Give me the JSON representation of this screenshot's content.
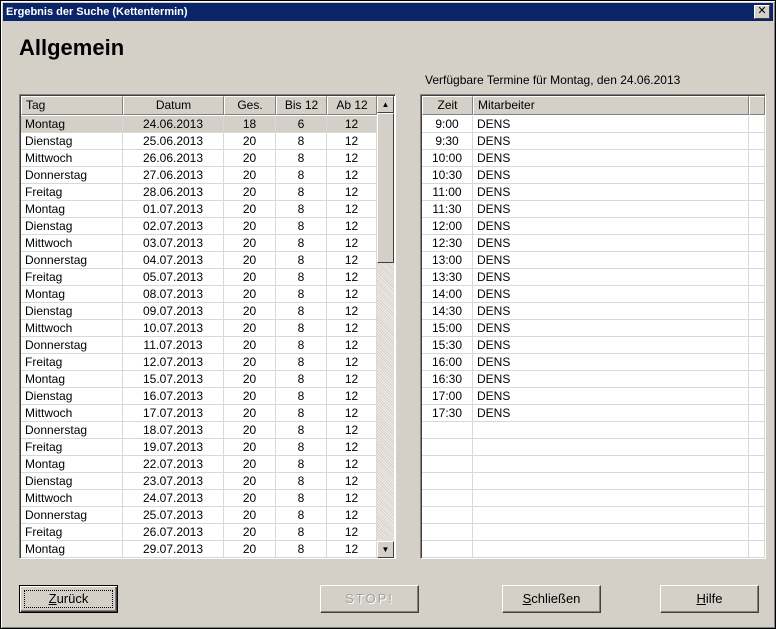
{
  "window": {
    "title": "Ergebnis der Suche (Kettentermin)",
    "close_glyph": "✕"
  },
  "heading": "Allgemein",
  "available_label": "Verfügbare Termine für  Montag, den 24.06.2013",
  "days_table": {
    "columns": [
      "Tag",
      "Datum",
      "Ges.",
      "Bis 12",
      "Ab 12"
    ],
    "selected_index": 0,
    "rows": [
      [
        "Montag",
        "24.06.2013",
        "18",
        "6",
        "12"
      ],
      [
        "Dienstag",
        "25.06.2013",
        "20",
        "8",
        "12"
      ],
      [
        "Mittwoch",
        "26.06.2013",
        "20",
        "8",
        "12"
      ],
      [
        "Donnerstag",
        "27.06.2013",
        "20",
        "8",
        "12"
      ],
      [
        "Freitag",
        "28.06.2013",
        "20",
        "8",
        "12"
      ],
      [
        "Montag",
        "01.07.2013",
        "20",
        "8",
        "12"
      ],
      [
        "Dienstag",
        "02.07.2013",
        "20",
        "8",
        "12"
      ],
      [
        "Mittwoch",
        "03.07.2013",
        "20",
        "8",
        "12"
      ],
      [
        "Donnerstag",
        "04.07.2013",
        "20",
        "8",
        "12"
      ],
      [
        "Freitag",
        "05.07.2013",
        "20",
        "8",
        "12"
      ],
      [
        "Montag",
        "08.07.2013",
        "20",
        "8",
        "12"
      ],
      [
        "Dienstag",
        "09.07.2013",
        "20",
        "8",
        "12"
      ],
      [
        "Mittwoch",
        "10.07.2013",
        "20",
        "8",
        "12"
      ],
      [
        "Donnerstag",
        "11.07.2013",
        "20",
        "8",
        "12"
      ],
      [
        "Freitag",
        "12.07.2013",
        "20",
        "8",
        "12"
      ],
      [
        "Montag",
        "15.07.2013",
        "20",
        "8",
        "12"
      ],
      [
        "Dienstag",
        "16.07.2013",
        "20",
        "8",
        "12"
      ],
      [
        "Mittwoch",
        "17.07.2013",
        "20",
        "8",
        "12"
      ],
      [
        "Donnerstag",
        "18.07.2013",
        "20",
        "8",
        "12"
      ],
      [
        "Freitag",
        "19.07.2013",
        "20",
        "8",
        "12"
      ],
      [
        "Montag",
        "22.07.2013",
        "20",
        "8",
        "12"
      ],
      [
        "Dienstag",
        "23.07.2013",
        "20",
        "8",
        "12"
      ],
      [
        "Mittwoch",
        "24.07.2013",
        "20",
        "8",
        "12"
      ],
      [
        "Donnerstag",
        "25.07.2013",
        "20",
        "8",
        "12"
      ],
      [
        "Freitag",
        "26.07.2013",
        "20",
        "8",
        "12"
      ],
      [
        "Montag",
        "29.07.2013",
        "20",
        "8",
        "12"
      ]
    ]
  },
  "slots_table": {
    "columns": [
      "Zeit",
      "Mitarbeiter"
    ],
    "rows": [
      [
        "9:00",
        "DENS"
      ],
      [
        "9:30",
        "DENS"
      ],
      [
        "10:00",
        "DENS"
      ],
      [
        "10:30",
        "DENS"
      ],
      [
        "11:00",
        "DENS"
      ],
      [
        "11:30",
        "DENS"
      ],
      [
        "12:00",
        "DENS"
      ],
      [
        "12:30",
        "DENS"
      ],
      [
        "13:00",
        "DENS"
      ],
      [
        "13:30",
        "DENS"
      ],
      [
        "14:00",
        "DENS"
      ],
      [
        "14:30",
        "DENS"
      ],
      [
        "15:00",
        "DENS"
      ],
      [
        "15:30",
        "DENS"
      ],
      [
        "16:00",
        "DENS"
      ],
      [
        "16:30",
        "DENS"
      ],
      [
        "17:00",
        "DENS"
      ],
      [
        "17:30",
        "DENS"
      ]
    ],
    "empty_rows": 8
  },
  "scrollbar": {
    "up_glyph": "▲",
    "down_glyph": "▼"
  },
  "buttons": {
    "back": {
      "pre": "",
      "key": "Z",
      "post": "urück"
    },
    "stop": "STOP!",
    "close": {
      "pre": "",
      "key": "S",
      "post": "chließen"
    },
    "help": {
      "pre": "",
      "key": "H",
      "post": "ilfe"
    }
  }
}
